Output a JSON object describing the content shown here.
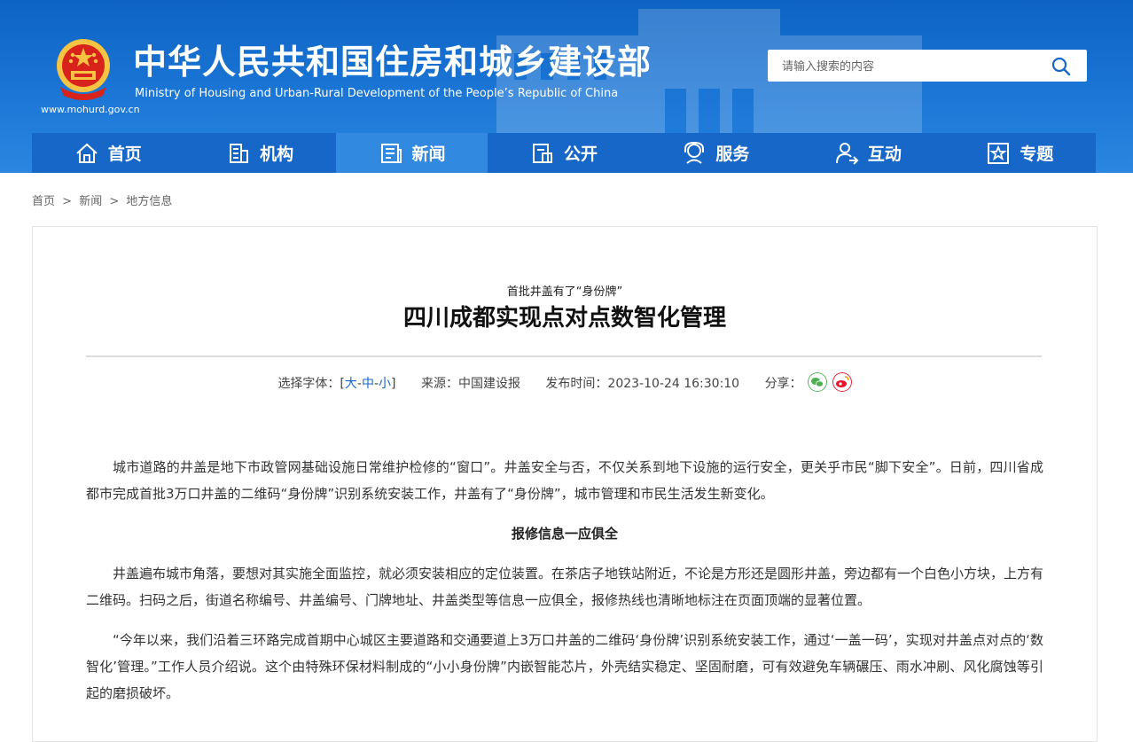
{
  "header": {
    "title": "中华人民共和国住房和城乡建设部",
    "subtitle": "Ministry of Housing and Urban-Rural Development of the People’s Republic of China",
    "url": "www.mohurd.gov.cn",
    "search_placeholder": "请输入搜索的内容"
  },
  "nav": {
    "items": [
      {
        "label": "首页",
        "icon": "home-icon"
      },
      {
        "label": "机构",
        "icon": "building-icon"
      },
      {
        "label": "新闻",
        "icon": "news-icon",
        "active": true
      },
      {
        "label": "公开",
        "icon": "folder-icon"
      },
      {
        "label": "服务",
        "icon": "service-icon"
      },
      {
        "label": "互动",
        "icon": "interact-icon"
      },
      {
        "label": "专题",
        "icon": "star-icon"
      }
    ],
    "active_color": "#3189e0",
    "bar_color": "#1767c8"
  },
  "breadcrumb": {
    "items": [
      "首页",
      "新闻",
      "地方信息"
    ],
    "separator": ">"
  },
  "article": {
    "pre_title": "首批井盖有了“身份牌”",
    "title": "四川成都实现点对点数智化管理",
    "font_label": "选择字体：[",
    "font_large": "大",
    "font_medium": "中",
    "font_small": "小",
    "font_sep": "-",
    "font_close": "]",
    "source": "来源：中国建设报",
    "publish_time": "发布时间：2023-10-24 16:30:10",
    "share_label": "分享：",
    "paragraphs": [
      "城市道路的井盖是地下市政管网基础设施日常维护检修的“窗口”。井盖安全与否，不仅关系到地下设施的运行安全，更关乎市民“脚下安全”。日前，四川省成都市完成首批3万口井盖的二维码“身份牌”识别系统安装工作，井盖有了“身份牌”，城市管理和市民生活发生新变化。",
      "井盖遍布城市角落，要想对其实施全面监控，就必须安装相应的定位装置。在茶店子地铁站附近，不论是方形还是圆形井盖，旁边都有一个白色小方块，上方有二维码。扫码之后，街道名称编号、井盖编号、门牌地址、井盖类型等信息一应俱全，报修热线也清晰地标注在页面顶端的显著位置。",
      "“今年以来，我们沿着三环路完成首期中心城区主要道路和交通要道上3万口井盖的二维码‘身份牌’识别系统安装工作，通过‘一盖一码’，实现对井盖点对点的‘数智化’管理。”工作人员介绍说。这个由特殊环保材料制成的“小小身份牌”内嵌智能芯片，外壳结实稳定、坚固耐磨，可有效避免车辆碾压、雨水冲刷、风化腐蚀等引起的磨损破坏。"
    ],
    "subheading": "报修信息一应俱全"
  }
}
